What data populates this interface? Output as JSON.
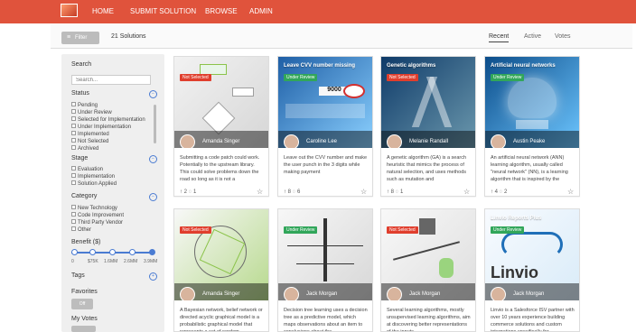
{
  "nav": {
    "home": "HOME",
    "submit": "SUBMIT SOLUTION",
    "browse": "BROWSE",
    "admin": "ADMIN"
  },
  "header": {
    "filter": "Filter",
    "count": "21 Solutions",
    "sort": {
      "recent": "Recent",
      "active": "Active",
      "votes": "Votes"
    }
  },
  "sidebar": {
    "search_title": "Search",
    "search_placeholder": "Search...",
    "status_title": "Status",
    "status_items": [
      "Pending",
      "Under Review",
      "Selected for Implementation",
      "Under Implementation",
      "Implemented",
      "Not Selected",
      "Archived"
    ],
    "stage_title": "Stage",
    "stage_items": [
      "Evaluation",
      "Implementation",
      "Solution Applied"
    ],
    "category_title": "Category",
    "category_items": [
      "New Technology",
      "Code Improvement",
      "Third Party Vendor",
      "Other"
    ],
    "benefit_title": "Benefit ($)",
    "benefit_ticks": [
      "0",
      "$75K",
      "1.6MM",
      "2.6MM",
      "3.9MM"
    ],
    "tags_title": "Tags",
    "favorites_title": "Favorites",
    "favorites_toggle": "Off",
    "myvotes_title": "My Votes"
  },
  "cards": [
    {
      "status": "Not Selected",
      "author": "Amanda Singer",
      "desc": "Submitting a code patch could work. Potentially to the upstream library. This could solve problems down the road so long as it is not a",
      "votes": "2",
      "comments": "1"
    },
    {
      "title": "Leave CVV number missing",
      "status": "Under Review",
      "author": "Caroline Lee",
      "desc": "Leave out the CVV number and make the user punch in the 3 digits while making payment",
      "votes": "8",
      "comments": "6"
    },
    {
      "title": "Genetic algorithms",
      "status": "Not Selected",
      "author": "Melanie Randall",
      "desc": "A genetic algorithm (GA) is a search heuristic that mimics the process of natural selection, and uses methods such as mutation and",
      "votes": "8",
      "comments": "1"
    },
    {
      "title": "Artificial neural networks",
      "status": "Under Review",
      "author": "Austin Peake",
      "desc": "An artificial neural network (ANN) learning algorithm, usually called \"neural network\" (NN), is a learning algorithm that is inspired by the",
      "votes": "4",
      "comments": "2"
    },
    {
      "status": "Not Selected",
      "author": "Amanda Singer",
      "desc": "A Bayesian network, belief network or directed acyclic graphical model is a probabilistic graphical model that represents a set of random",
      "votes": "",
      "comments": ""
    },
    {
      "status": "Under Review",
      "author": "Jack Morgan",
      "desc": "Decision tree learning uses a decision tree as a predictive model, which maps observations about an item to conclusions about the",
      "votes": "",
      "comments": ""
    },
    {
      "status": "Not Selected",
      "author": "Jack Morgan",
      "desc": "Several learning algorithms, mostly unsupervised learning algorithms, aim at discovering better representations of the inputs",
      "votes": "",
      "comments": ""
    },
    {
      "title": "Linvio Reports Plus",
      "status": "Under Review",
      "author": "Jack Morgan",
      "desc": "Linvio is a Salesforce ISV partner with over 10 years experience building commerce solutions and custom integrations specifically for",
      "votes": "",
      "comments": ""
    }
  ]
}
